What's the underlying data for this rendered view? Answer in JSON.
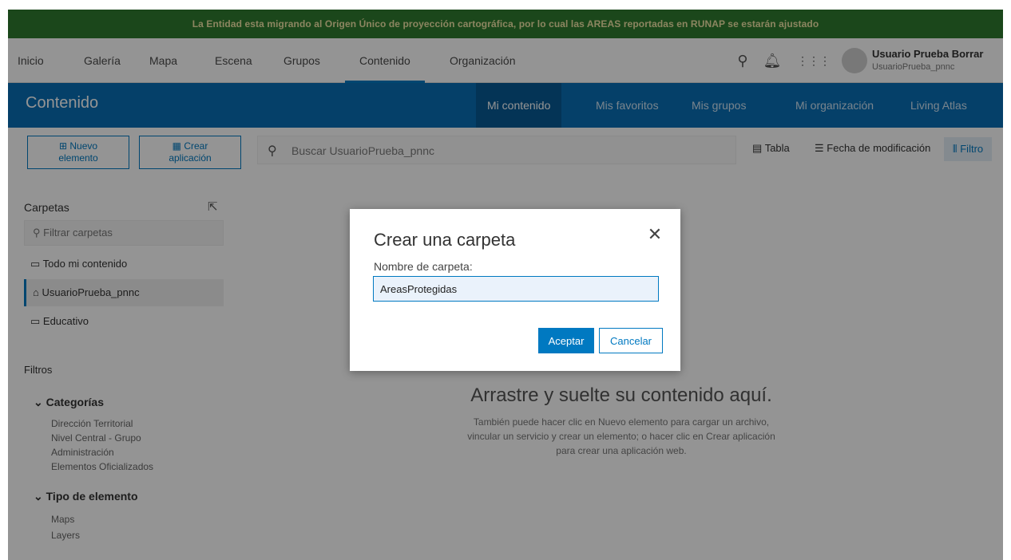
{
  "banner": {
    "text": "La Entidad esta migrando al Origen Único de proyección cartográfica, por lo cual las AREAS reportadas en RUNAP se estarán ajustado"
  },
  "topnav": {
    "items": [
      "Inicio",
      "Galería",
      "Mapa",
      "Escena",
      "Grupos",
      "Contenido",
      "Organización"
    ],
    "active": "Contenido",
    "user_name": "Usuario Prueba Borrar",
    "user_id": "UsuarioPrueba_pnnc"
  },
  "header": {
    "title": "Contenido",
    "tabs": [
      "Mi contenido",
      "Mis favoritos",
      "Mis grupos",
      "Mi organización",
      "Living Atlas"
    ],
    "active_tab": "Mi contenido"
  },
  "toolbar": {
    "new_item_line1": "Nuevo",
    "new_item_line2": "elemento",
    "create_app_line1": "Crear",
    "create_app_line2": "aplicación",
    "search_placeholder": "Buscar UsuarioPrueba_pnnc",
    "table_label": "Tabla",
    "sort_label": "Fecha de modificación",
    "filter_label": "Filtro"
  },
  "sidebar": {
    "folders_title": "Carpetas",
    "filter_placeholder": "Filtrar carpetas",
    "folders": [
      "Todo mi contenido",
      "UsuarioPrueba_pnnc",
      "Educativo"
    ],
    "selected_folder": "UsuarioPrueba_pnnc",
    "filters_title": "Filtros",
    "categories_title": "Categorías",
    "categories": [
      "Dirección Territorial",
      "Nivel Central - Grupo",
      "Administración",
      "Elementos Oficializados"
    ],
    "item_type_title": "Tipo de elemento",
    "item_types": [
      "Maps",
      "Layers"
    ]
  },
  "main": {
    "drop_title": "Arrastre y suelte su contenido aquí.",
    "drop_line1": "También puede hacer clic en Nuevo elemento para cargar un archivo,",
    "drop_line2": "vincular un servicio y crear un elemento; o hacer clic en Crear aplicación",
    "drop_line3": "para crear una aplicación web."
  },
  "modal": {
    "title": "Crear una carpeta",
    "label": "Nombre de carpeta:",
    "value": "AreasProtegidas",
    "ok_label": "Aceptar",
    "cancel_label": "Cancelar"
  },
  "colors": {
    "accent": "#0079c1",
    "header": "#0a6fb5",
    "banner": "#2f7a2f"
  }
}
